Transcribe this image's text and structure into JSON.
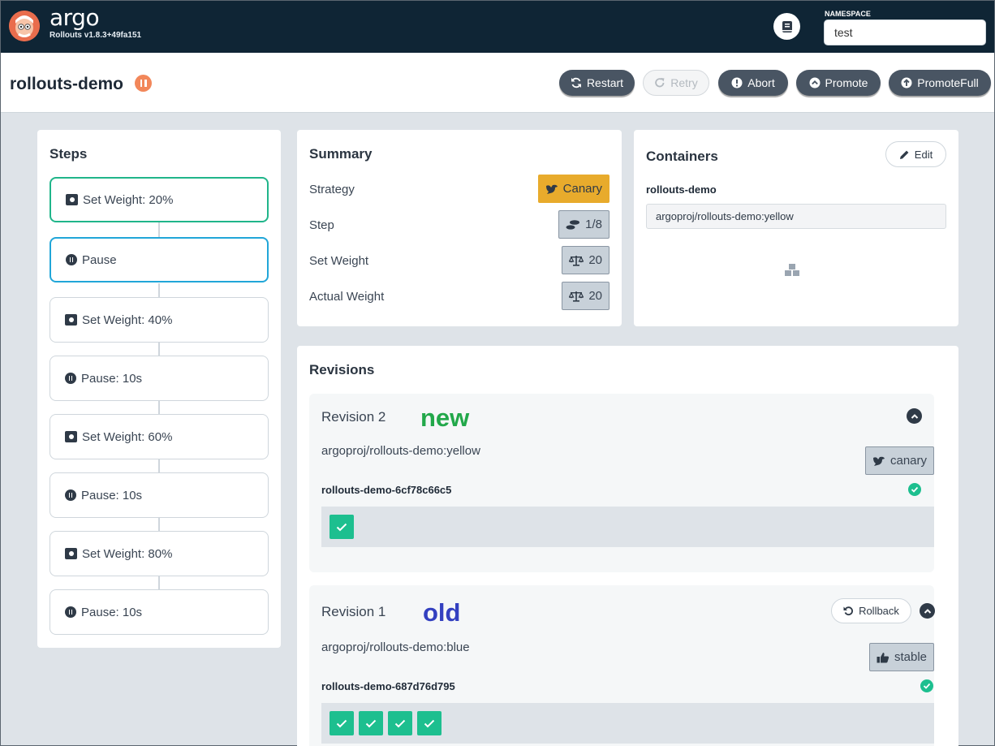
{
  "app": {
    "name": "argo",
    "version": "Rollouts v1.8.3+49fa151"
  },
  "namespace": {
    "label": "NAMESPACE",
    "value": "test"
  },
  "rollout": {
    "name": "rollouts-demo",
    "status": "paused"
  },
  "actions": {
    "restart": "Restart",
    "retry": "Retry",
    "abort": "Abort",
    "promote": "Promote",
    "promote_full": "PromoteFull"
  },
  "steps": {
    "title": "Steps",
    "items": [
      {
        "label": "Set Weight: 20%",
        "kind": "weight",
        "state": "complete"
      },
      {
        "label": "Pause",
        "kind": "pause",
        "state": "current"
      },
      {
        "label": "Set Weight: 40%",
        "kind": "weight",
        "state": "pending"
      },
      {
        "label": "Pause: 10s",
        "kind": "pause",
        "state": "pending"
      },
      {
        "label": "Set Weight: 60%",
        "kind": "weight",
        "state": "pending"
      },
      {
        "label": "Pause: 10s",
        "kind": "pause",
        "state": "pending"
      },
      {
        "label": "Set Weight: 80%",
        "kind": "weight",
        "state": "pending"
      },
      {
        "label": "Pause: 10s",
        "kind": "pause",
        "state": "pending"
      }
    ]
  },
  "summary": {
    "title": "Summary",
    "rows": [
      {
        "label": "Strategy",
        "value": "Canary",
        "icon": "dove-icon"
      },
      {
        "label": "Step",
        "value": "1/8",
        "icon": "shoe-prints-icon"
      },
      {
        "label": "Set Weight",
        "value": "20",
        "icon": "balance-scale-icon"
      },
      {
        "label": "Actual Weight",
        "value": "20",
        "icon": "balance-scale-icon"
      }
    ],
    "canary_color": "#e8ab2c"
  },
  "containers": {
    "title": "Containers",
    "edit_label": "Edit",
    "container_name": "rollouts-demo",
    "image": "argoproj/rollouts-demo:yellow"
  },
  "revisions": {
    "title": "Revisions",
    "items": [
      {
        "label": "Revision 2",
        "tag": "new",
        "tag_color": "#22a84a",
        "image": "argoproj/rollouts-demo:yellow",
        "badge": "canary",
        "replicaset": "rollouts-demo-6cf78c66c5",
        "pods": 1
      },
      {
        "label": "Revision 1",
        "tag": "old",
        "tag_color": "#3340c0",
        "image": "argoproj/rollouts-demo:blue",
        "badge": "stable",
        "rollback_label": "Rollback",
        "replicaset": "rollouts-demo-687d76d795",
        "pods": 4
      }
    ]
  },
  "colors": {
    "topbar": "#0f2535",
    "healthy": "#1dbf8f",
    "step_complete": "#20b58a",
    "step_current": "#21a6d8",
    "paused": "#f2875a"
  }
}
